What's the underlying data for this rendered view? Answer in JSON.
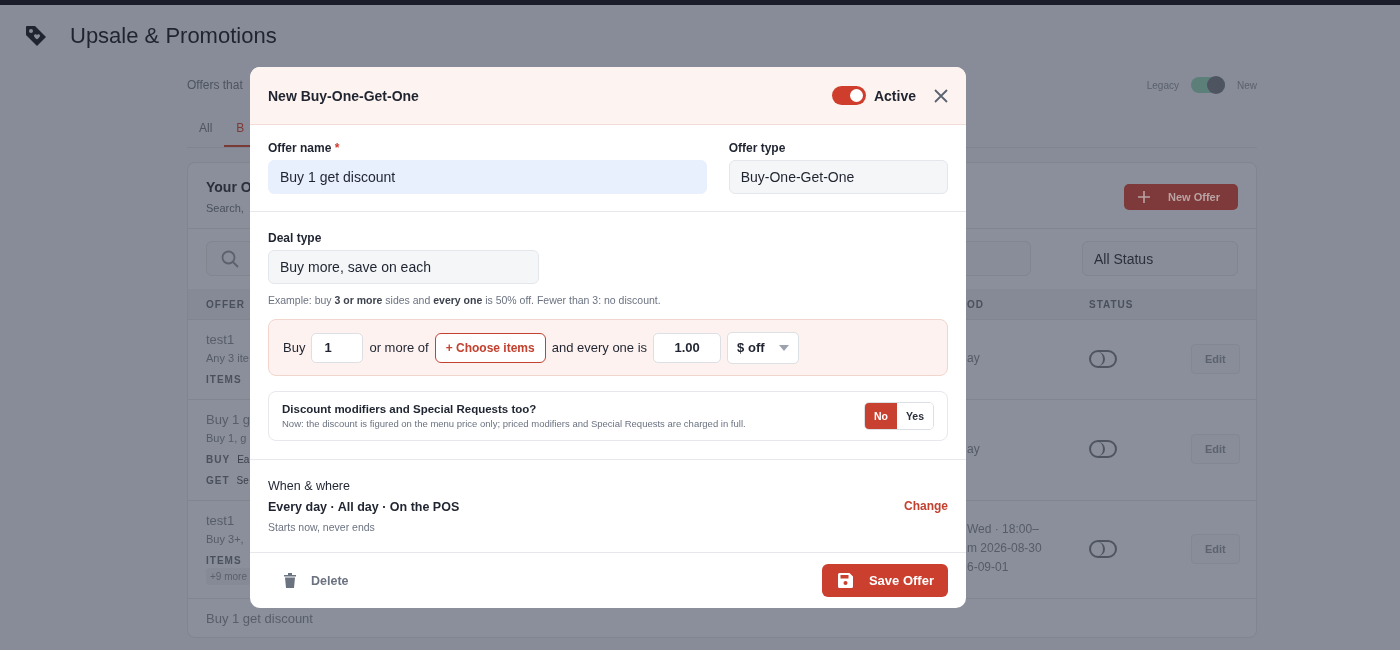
{
  "header": {
    "title": "Upsale & Promotions"
  },
  "page": {
    "subtitle": "Offers that",
    "mode": {
      "left_label": "Legacy",
      "right_label": "New",
      "on": true
    },
    "tabs": [
      {
        "label": "All",
        "selected": false
      },
      {
        "label": "B",
        "selected": true
      }
    ],
    "card": {
      "title": "Your O",
      "subtitle": "Search,",
      "new_button": "New Offer",
      "status_filter": "All Status",
      "columns": [
        "OFFER",
        "OD",
        "STATUS"
      ],
      "rows": [
        {
          "name": "test1",
          "summary": "Any 3 ite",
          "tags": [
            {
              "kind": "tag",
              "label": "ITEMS"
            }
          ],
          "period": [
            "ay"
          ],
          "on": false,
          "action": "Edit"
        },
        {
          "name": "Buy 1 g",
          "summary": "Buy 1, g",
          "tags": [
            {
              "kind": "tag",
              "label": "BUY",
              "value": "Ea"
            },
            {
              "kind": "tag",
              "label": "GET",
              "value": "Se"
            }
          ],
          "period": [
            "ay"
          ],
          "on": false,
          "action": "Edit"
        },
        {
          "name": "test1",
          "summary": "Buy 3+,",
          "tags": [
            {
              "kind": "tag",
              "label": "ITEMS"
            },
            {
              "kind": "chip",
              "label": "+9 more"
            }
          ],
          "period": [
            "Wed · 18:00–",
            "m 2026-08-30",
            "6-09-01"
          ],
          "on": false,
          "action": "Edit"
        },
        {
          "name": "Buy 1 get discount"
        }
      ]
    }
  },
  "dialog": {
    "title": "New Buy-One-Get-One",
    "active": {
      "label": "Active",
      "on": true
    },
    "fields": [
      {
        "label": "Offer name",
        "required_mark": "*",
        "value": "Buy 1 get discount",
        "highlighted": true
      },
      {
        "label": "Offer type",
        "value": "Buy-One-Get-One",
        "highlighted": false
      }
    ],
    "deal": {
      "label": "Deal type",
      "value": "Buy more, save on each",
      "example": "Example: buy **3 or more** sides and **every one** is 50% off. Fewer than 3: no discount.",
      "rule": [
        {
          "kind": "text",
          "text": "Buy"
        },
        {
          "kind": "input",
          "value": "1"
        },
        {
          "kind": "text",
          "text": "or more of"
        },
        {
          "kind": "button",
          "text": "+ Choose items"
        },
        {
          "kind": "text",
          "text": "and every one is"
        },
        {
          "kind": "input",
          "value": "1.00"
        },
        {
          "kind": "select",
          "value": "$ off"
        }
      ]
    },
    "modifiers": {
      "title": "Discount modifiers and Special Requests too?",
      "note": "Now: the discount is figured on the menu price only; priced modifiers and Special Requests are charged in full.",
      "options": [
        {
          "label": "No",
          "selected": true
        },
        {
          "label": "Yes",
          "selected": false
        }
      ]
    },
    "schedule": {
      "title": "When & where",
      "summary": "Every day · All day · On the POS",
      "note": "Starts now, never ends",
      "change": "Change"
    },
    "footer": {
      "delete": "Delete",
      "save": "Save Offer"
    }
  }
}
